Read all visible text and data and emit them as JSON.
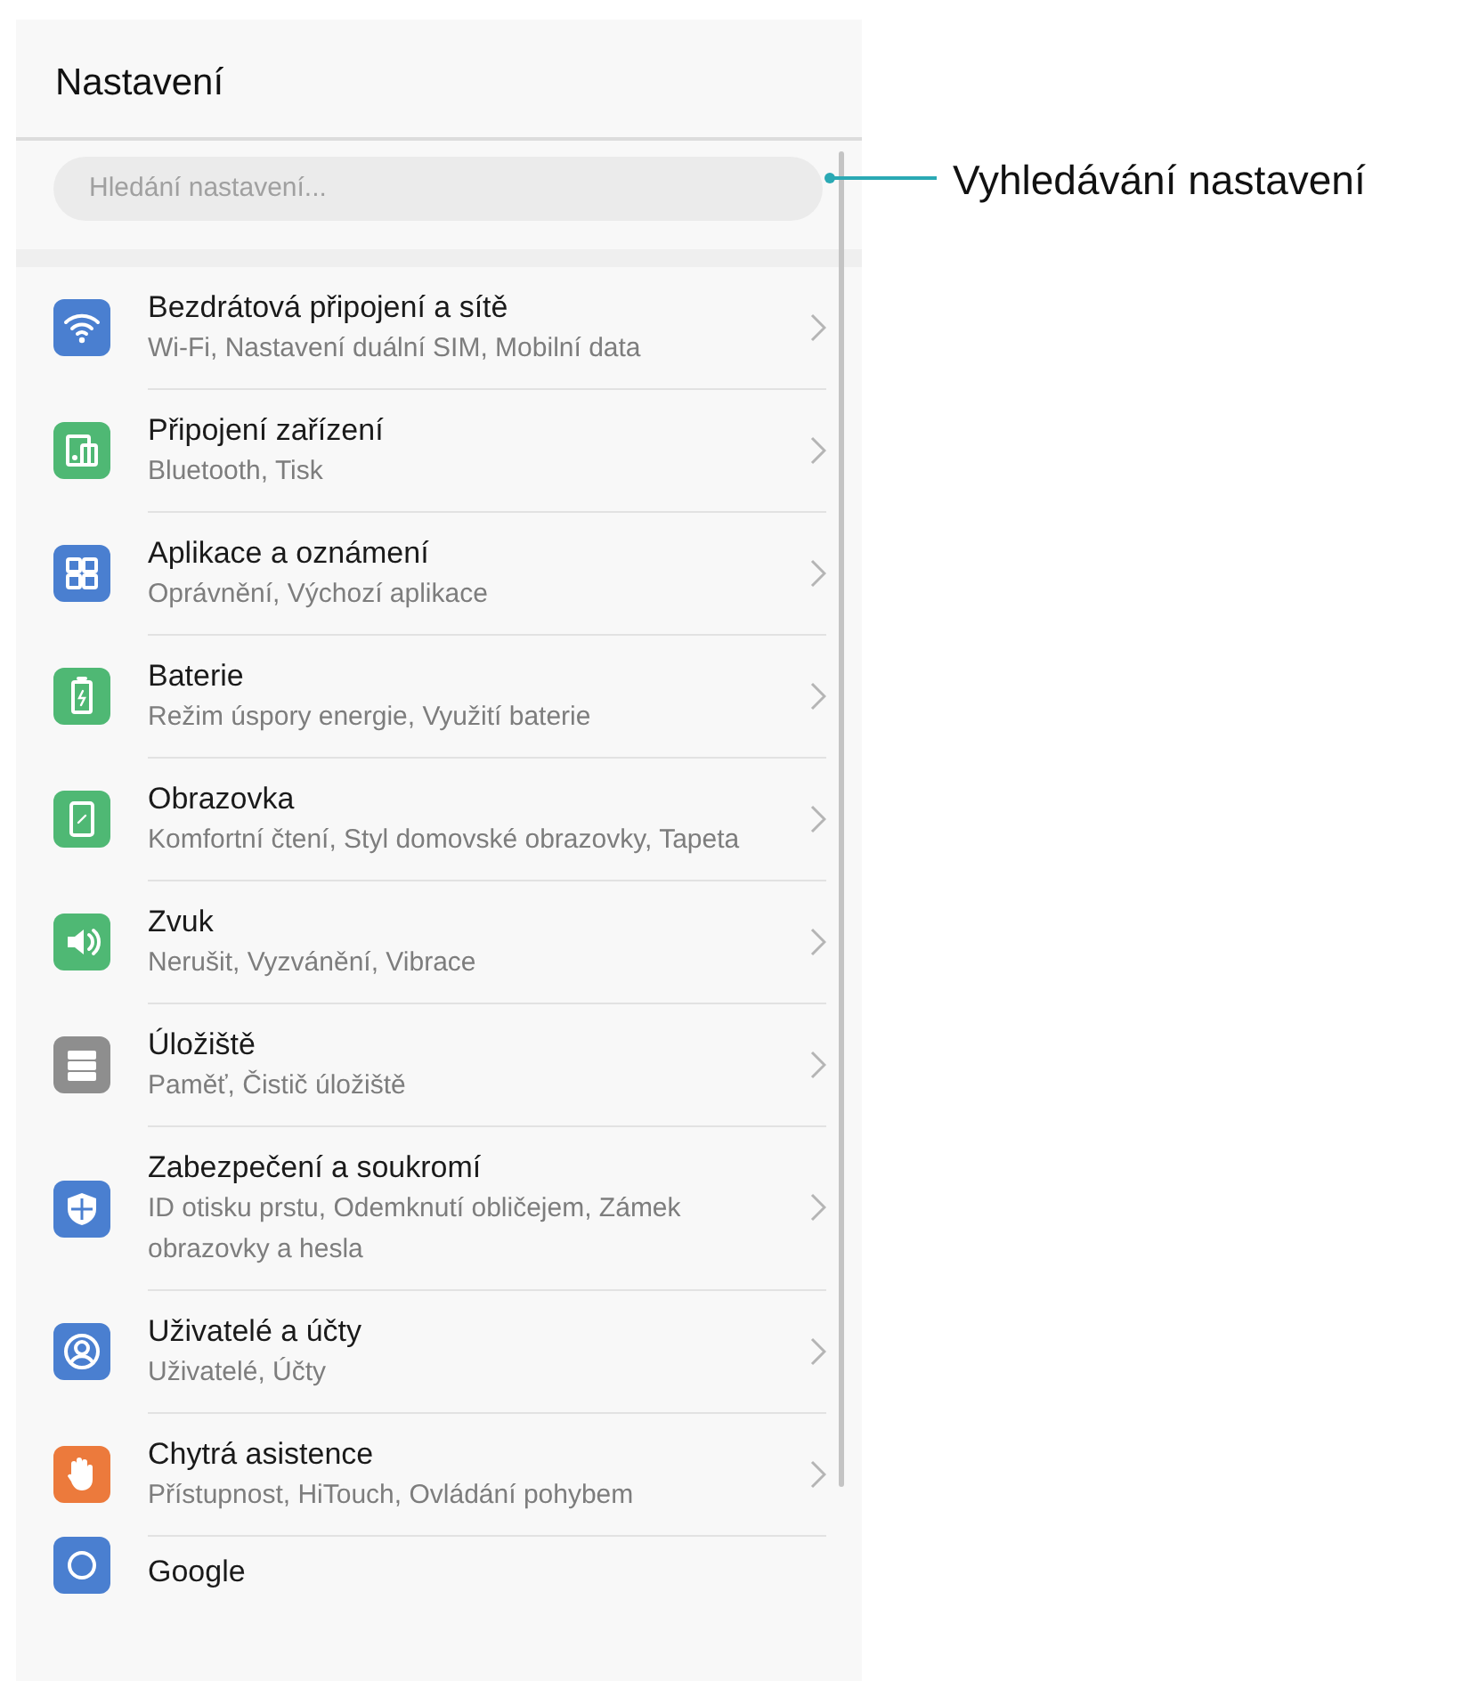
{
  "header": {
    "title": "Nastavení"
  },
  "search": {
    "placeholder": "Hledání nastavení..."
  },
  "callout": {
    "label": "Vyhledávání nastavení"
  },
  "items": [
    {
      "kind": "wifi",
      "color": "#4a7fd0",
      "title": "Bezdrátová připojení a sítě",
      "subtitle": "Wi-Fi, Nastavení duální SIM, Mobilní data"
    },
    {
      "kind": "devices",
      "color": "#4fb874",
      "title": "Připojení zařízení",
      "subtitle": "Bluetooth, Tisk"
    },
    {
      "kind": "apps",
      "color": "#4a7fd0",
      "title": "Aplikace a oznámení",
      "subtitle": "Oprávnění, Výchozí aplikace"
    },
    {
      "kind": "battery",
      "color": "#4fb874",
      "title": "Baterie",
      "subtitle": "Režim úspory energie, Využití baterie"
    },
    {
      "kind": "display",
      "color": "#4fb874",
      "title": "Obrazovka",
      "subtitle": "Komfortní čtení, Styl domovské obrazovky, Tapeta"
    },
    {
      "kind": "sound",
      "color": "#4fb874",
      "title": "Zvuk",
      "subtitle": "Nerušit, Vyzvánění, Vibrace"
    },
    {
      "kind": "storage",
      "color": "#8e8e8e",
      "title": "Úložiště",
      "subtitle": "Paměť, Čistič úložiště"
    },
    {
      "kind": "shield",
      "color": "#4a7fd0",
      "title": "Zabezpečení a soukromí",
      "subtitle": "ID otisku prstu, Odemknutí obličejem, Zámek obrazovky a hesla"
    },
    {
      "kind": "user",
      "color": "#4a7fd0",
      "title": "Uživatelé a účty",
      "subtitle": "Uživatelé, Účty"
    },
    {
      "kind": "hand",
      "color": "#ec7a3c",
      "title": "Chytrá asistence",
      "subtitle": "Přístupnost, HiTouch, Ovládání pohybem"
    },
    {
      "kind": "google",
      "color": "#4a7fd0",
      "title": "Google"
    }
  ]
}
